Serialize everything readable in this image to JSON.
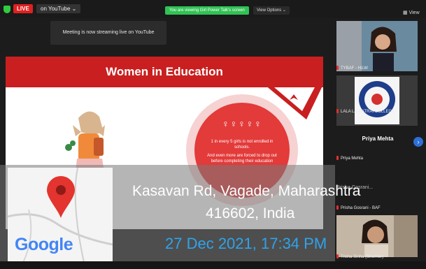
{
  "header": {
    "live_badge": "LIVE",
    "stream_dropdown": "on YouTube",
    "viewing_notice": "You are viewing Girl Power Talk's screen",
    "view_options": "View Options",
    "view_button": "View"
  },
  "toast": "Meeting is now streaming live on YouTube",
  "slide": {
    "title": "Women in Education",
    "figures": "♀♀♀♀♀",
    "stat1": "1 in every 5 girls is not enrolled in schools.",
    "stat2": "And even more are forced to drop out before completing their education",
    "colors": {
      "banner": "#c91f20",
      "circle": "#e33a3a"
    }
  },
  "participants": [
    {
      "name": "TYBAF - HiLW"
    },
    {
      "name": "LALA LAJPATRAI COLLEGE"
    },
    {
      "name": "Priya Mehta",
      "center_label": "Priya Mehta"
    },
    {
      "name": "Prisha Gosrani - BAF",
      "center_label": "Prisha Gosrani..."
    },
    {
      "name": "Trisha Sinha (She/Her)"
    }
  ],
  "location": {
    "address_line1": "Kasavan Rd, Vagade, Maharashtra",
    "address_line2": "416602, India",
    "datetime": "27 Dec 2021, 17:34 PM",
    "map_logo": "Google",
    "pin_icon": "map-pin-icon"
  }
}
